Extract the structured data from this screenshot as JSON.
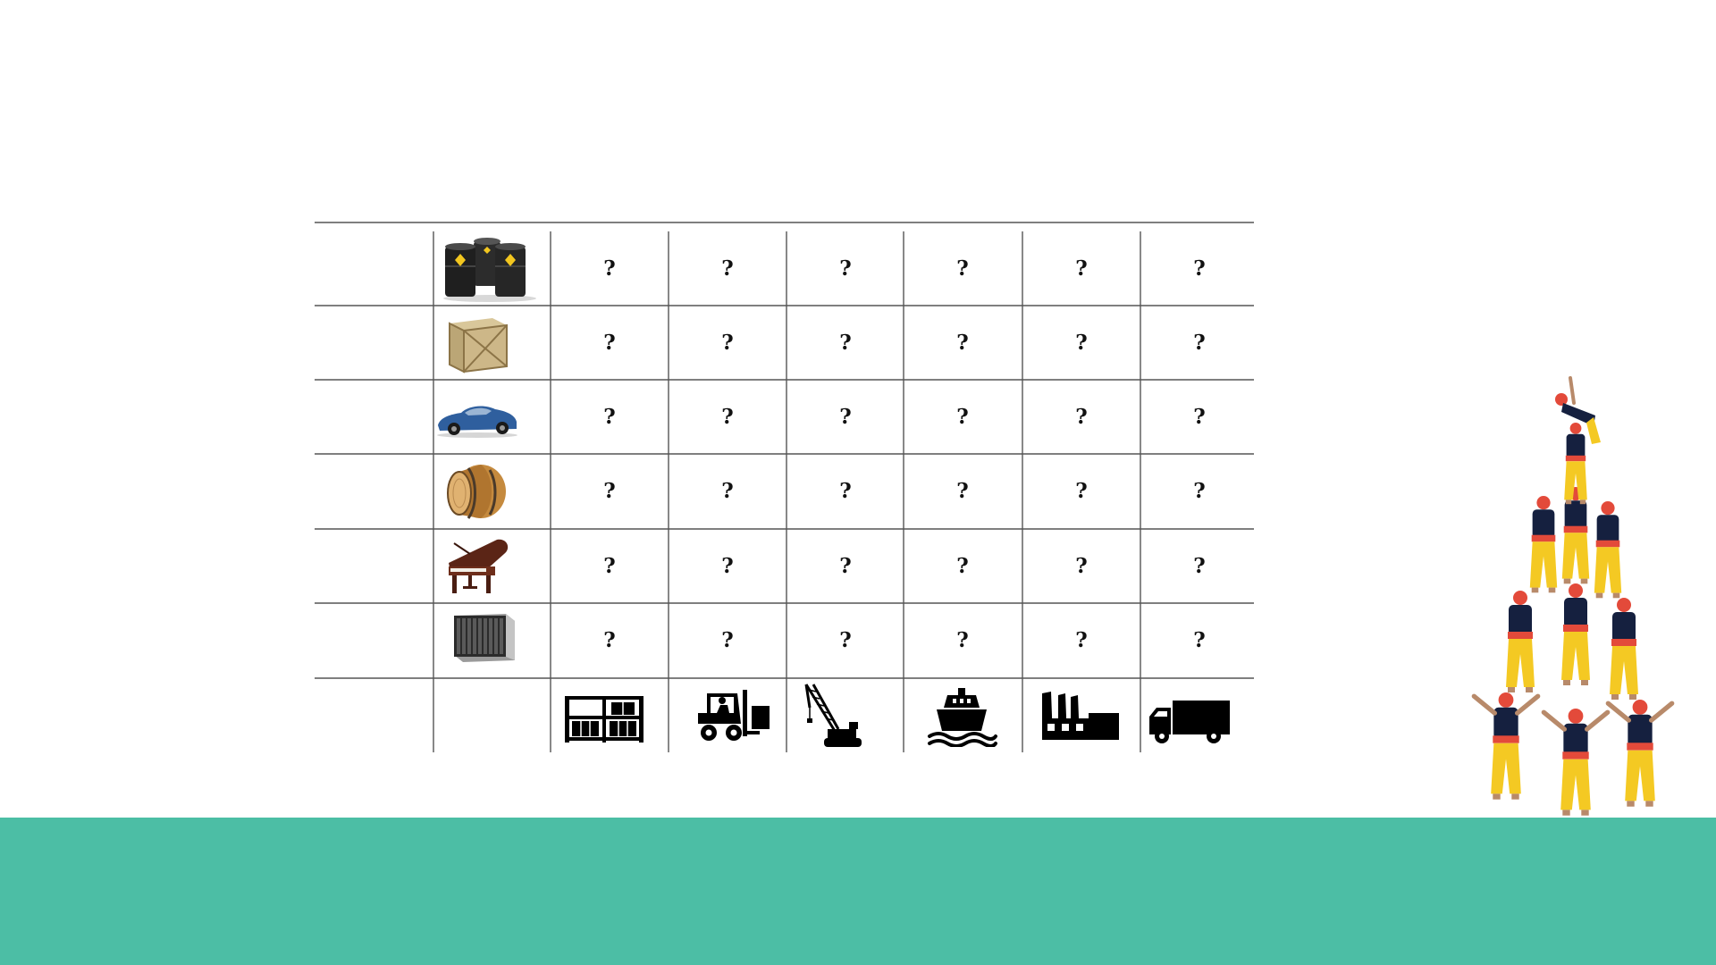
{
  "colors": {
    "background": "#ffffff",
    "ground": "#4cbea5",
    "grid_line": "#555555",
    "question_mark": "#111111",
    "silhouette": "#000000",
    "tower_shirt": "#15203f",
    "tower_pants": "#f4c923",
    "tower_sash": "#e34a3a",
    "tower_skin": "#b88a6a"
  },
  "table": {
    "rows": [
      {
        "item_icon": "oil-barrels-icon",
        "cells": [
          "?",
          "?",
          "?",
          "?",
          "?",
          "?"
        ]
      },
      {
        "item_icon": "wooden-crate-icon",
        "cells": [
          "?",
          "?",
          "?",
          "?",
          "?",
          "?"
        ]
      },
      {
        "item_icon": "sports-car-icon",
        "cells": [
          "?",
          "?",
          "?",
          "?",
          "?",
          "?"
        ]
      },
      {
        "item_icon": "wooden-barrel-icon",
        "cells": [
          "?",
          "?",
          "?",
          "?",
          "?",
          "?"
        ]
      },
      {
        "item_icon": "grand-piano-icon",
        "cells": [
          "?",
          "?",
          "?",
          "?",
          "?",
          "?"
        ]
      },
      {
        "item_icon": "server-rack-icon",
        "cells": [
          "?",
          "?",
          "?",
          "?",
          "?",
          "?"
        ]
      }
    ],
    "transport_icons": [
      "storage-rack-icon",
      "forklift-icon",
      "crane-icon",
      "ship-icon",
      "factory-icon",
      "truck-icon"
    ]
  },
  "decoration": {
    "icon": "human-tower-icon"
  }
}
